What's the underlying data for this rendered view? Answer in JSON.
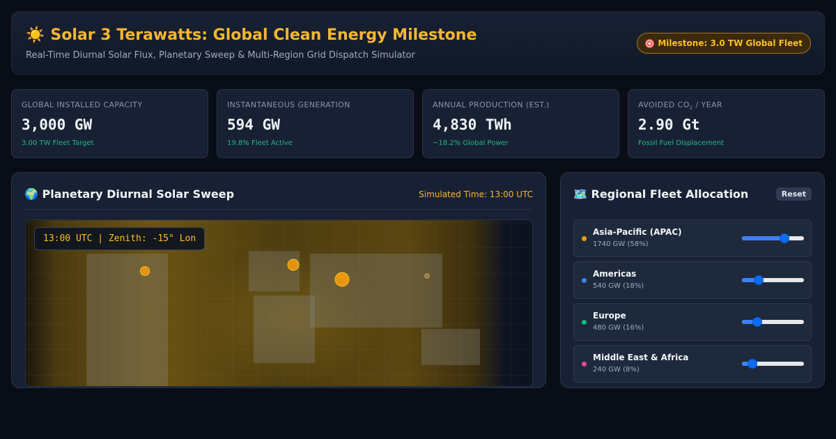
{
  "header": {
    "title": "Solar 3 Terawatts: Global Clean Energy Milestone",
    "subtitle": "Real-Time Diurnal Solar Flux, Planetary Sweep & Multi-Region Grid Dispatch Simulator",
    "milestone_badge": "Milestone: 3.0 TW Global Fleet",
    "title_icon": "sun-icon",
    "badge_icon": "target-icon"
  },
  "stats": [
    {
      "label": "GLOBAL INSTALLED CAPACITY",
      "value": "3,000 GW",
      "sub": "3.00 TW Fleet Target"
    },
    {
      "label": "INSTANTANEOUS GENERATION",
      "value": "594 GW",
      "sub": "19.8% Fleet Active"
    },
    {
      "label": "ANNUAL PRODUCTION (EST.)",
      "value": "4,830 TWh",
      "sub": "~18.2% Global Power"
    },
    {
      "label_prefix": "AVOIDED CO",
      "label_subscript": "2",
      "label_suffix": " / YEAR",
      "value": "2.90 Gt",
      "sub": "Fossil Fuel Displacement"
    }
  ],
  "sweep": {
    "title": "🌍 Planetary Diurnal Solar Sweep",
    "time_label": "Simulated Time: 13:00 UTC",
    "utc_readout": "13:00 UTC | Zenith: -15° Lon"
  },
  "regional": {
    "title": "🗺️ Regional Fleet Allocation",
    "reset_label": "Reset",
    "regions": [
      {
        "name": "Asia-Pacific (APAC)",
        "detail": "1740 GW (58%)",
        "color": "#f59e0b",
        "level": 0.58
      },
      {
        "name": "Americas",
        "detail": "540 GW (18%)",
        "color": "#3b82f6",
        "level": 0.18
      },
      {
        "name": "Europe",
        "detail": "480 GW (16%)",
        "color": "#10b981",
        "level": 0.16
      },
      {
        "name": "Middle East & Africa",
        "detail": "240 GW (8%)",
        "color": "#ec4899",
        "level": 0.08
      }
    ]
  },
  "colors": {
    "accent": "#f5b731",
    "positive": "#22b889",
    "background": "#090d16",
    "card": "#182133"
  }
}
